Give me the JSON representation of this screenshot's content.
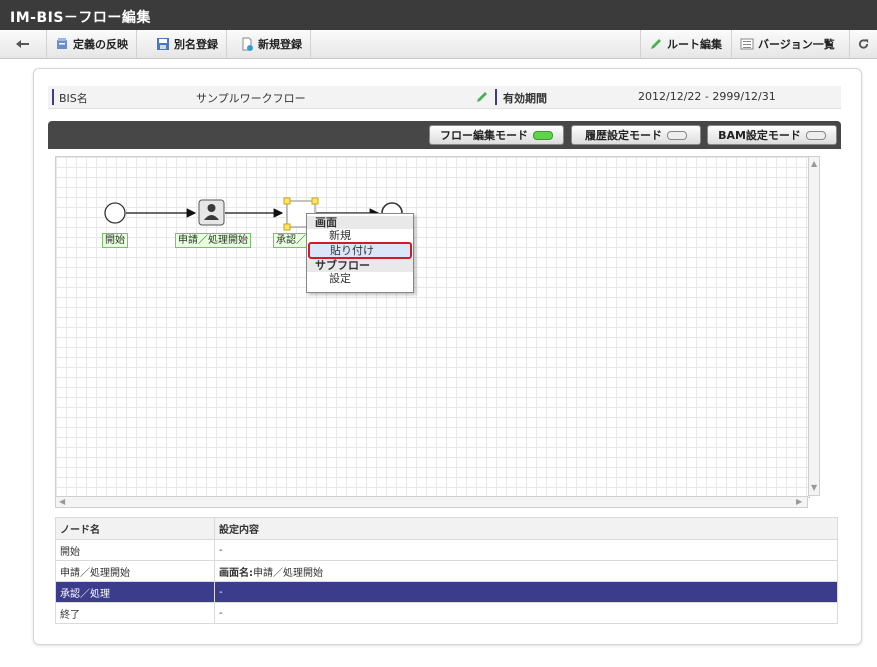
{
  "window": {
    "title": "IM-BIS－フロー編集"
  },
  "toolbar": {
    "back": "back",
    "apply": "定義の反映",
    "save_as": "別名登録",
    "new": "新規登録",
    "route_edit": "ルート編集",
    "version_list": "バージョン一覧"
  },
  "info": {
    "bis_label": "BIS名",
    "bis_name": "サンプルワークフロー",
    "period_label": "有効期間",
    "period_value": "2012/12/22 - 2999/12/31"
  },
  "modes": [
    {
      "label": "フロー編集モード",
      "active": true
    },
    {
      "label": "履歴設定モード",
      "active": false
    },
    {
      "label": "BAM設定モード",
      "active": false
    }
  ],
  "flow": {
    "nodes": [
      {
        "label": "開始",
        "type": "start"
      },
      {
        "label": "申請／処理開始",
        "type": "user"
      },
      {
        "label": "承認／",
        "type": "task"
      },
      {
        "label": "",
        "type": "end"
      }
    ]
  },
  "context_menu": {
    "section1": "画面",
    "item_new": "新規",
    "item_paste": "貼り付け",
    "section2": "サブフロー",
    "item_settings": "設定"
  },
  "table": {
    "headers": [
      "ノード名",
      "設定内容"
    ],
    "rows": [
      {
        "name": "開始",
        "label": "",
        "value": "-",
        "selected": false
      },
      {
        "name": "申請／処理開始",
        "label": "画面名:",
        "value": "申請／処理開始",
        "selected": false
      },
      {
        "name": "承認／処理",
        "label": "",
        "value": "-",
        "selected": true
      },
      {
        "name": "終了",
        "label": "",
        "value": "-",
        "selected": false
      }
    ]
  },
  "colors": {
    "titlebar": "#3b3b3b",
    "accent": "#3c3c8c",
    "led_on": "#61d34a",
    "highlight": "#d11b2a"
  }
}
